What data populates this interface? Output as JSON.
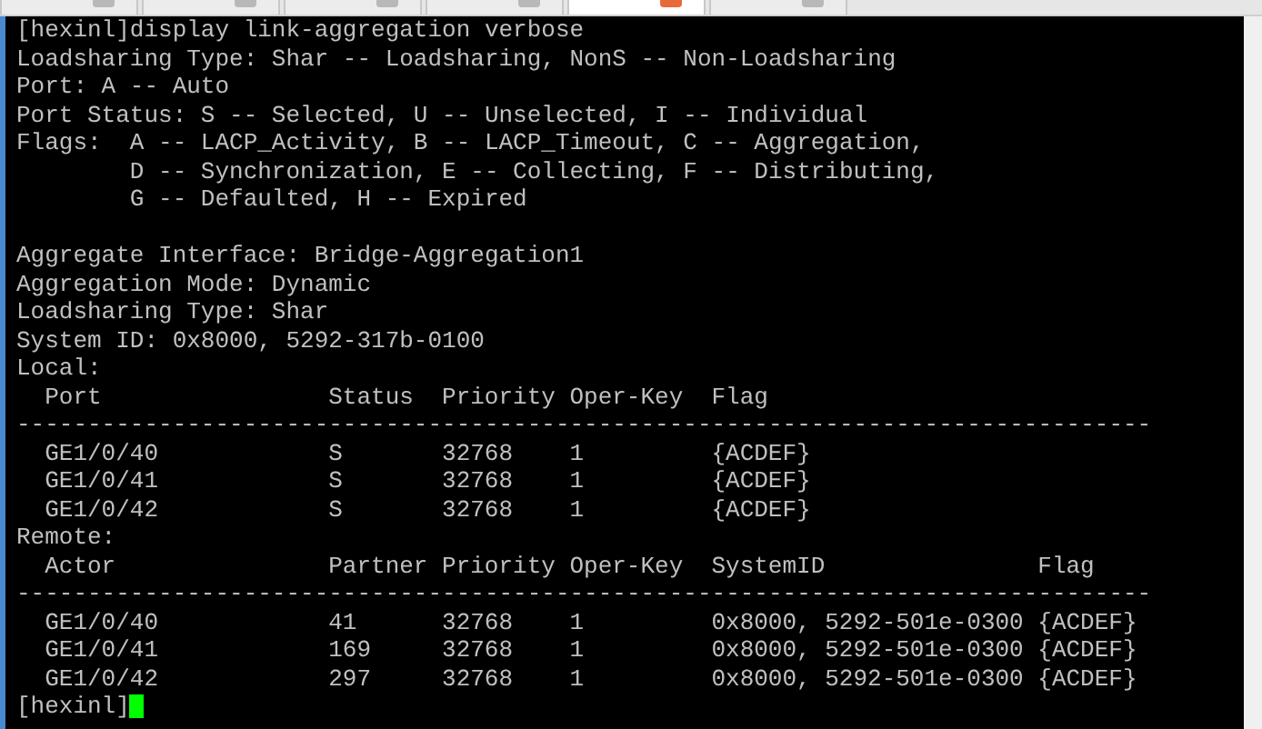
{
  "tabs": [
    {
      "selected": false
    },
    {
      "selected": false
    },
    {
      "selected": false
    },
    {
      "selected": false
    },
    {
      "selected": true
    },
    {
      "selected": false
    }
  ],
  "terminal": {
    "command": "[hexinl]display link-aggregation verbose",
    "legend": [
      "Loadsharing Type: Shar -- Loadsharing, NonS -- Non-Loadsharing",
      "Port: A -- Auto",
      "Port Status: S -- Selected, U -- Unselected, I -- Individual",
      "Flags:  A -- LACP_Activity, B -- LACP_Timeout, C -- Aggregation,",
      "        D -- Synchronization, E -- Collecting, F -- Distributing,",
      "        G -- Defaulted, H -- Expired"
    ],
    "details": [
      "Aggregate Interface: Bridge-Aggregation1",
      "Aggregation Mode: Dynamic",
      "Loadsharing Type: Shar",
      "System ID: 0x8000, 5292-317b-0100"
    ],
    "local": {
      "title": "Local:",
      "separator": "--------------------------------------------------------------------------------",
      "columns": [
        "Port",
        "Status",
        "Priority",
        "Oper-Key",
        "Flag"
      ],
      "rows": [
        [
          "GE1/0/40",
          "S",
          "32768",
          "1",
          "{ACDEF}"
        ],
        [
          "GE1/0/41",
          "S",
          "32768",
          "1",
          "{ACDEF}"
        ],
        [
          "GE1/0/42",
          "S",
          "32768",
          "1",
          "{ACDEF}"
        ]
      ]
    },
    "remote": {
      "title": "Remote:",
      "separator": "--------------------------------------------------------------------------------",
      "columns": [
        "Actor",
        "Partner",
        "Priority",
        "Oper-Key",
        "SystemID",
        "Flag"
      ],
      "rows": [
        [
          "GE1/0/40",
          "41",
          "32768",
          "1",
          "0x8000, 5292-501e-0300",
          "{ACDEF}"
        ],
        [
          "GE1/0/41",
          "169",
          "32768",
          "1",
          "0x8000, 5292-501e-0300",
          "{ACDEF}"
        ],
        [
          "GE1/0/42",
          "297",
          "32768",
          "1",
          "0x8000, 5292-501e-0300",
          "{ACDEF}"
        ]
      ]
    },
    "prompt": "[hexinl]"
  }
}
